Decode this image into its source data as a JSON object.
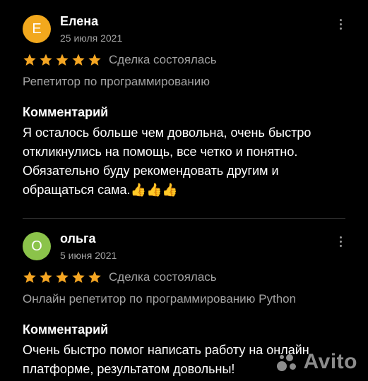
{
  "reviews": [
    {
      "initial": "Е",
      "avatar_color": "#f2a81d",
      "name": "Елена",
      "date": "25 июля 2021",
      "rating": 5,
      "deal_status": "Сделка состоялась",
      "service": "Репетитор по программированию",
      "comment_title": "Комментарий",
      "comment": "Я осталось больше чем довольна, очень быстро откликнулись на помощь, все четко и понятно. Обязательно буду рекомендовать другим и обращаться сама.👍👍👍"
    },
    {
      "initial": "О",
      "avatar_color": "#8bc34a",
      "name": "ольга",
      "date": "5 июня 2021",
      "rating": 5,
      "deal_status": "Сделка состоялась",
      "service": "Онлайн репетитор по программированию Python",
      "comment_title": "Комментарий",
      "comment": "Очень быстро помог написать работу на онлайн платформе, результатом довольны!"
    }
  ],
  "colors": {
    "background": "#000000",
    "star": "#f5a623",
    "muted_text": "#a3a3a3"
  },
  "watermark": {
    "text": "Avito"
  }
}
